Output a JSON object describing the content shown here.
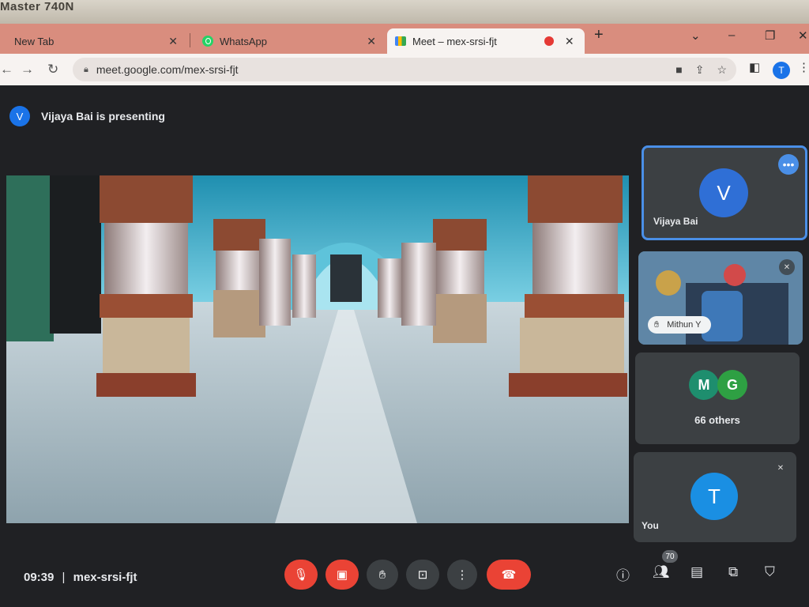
{
  "monitor": {
    "brand": "Master 740N"
  },
  "browser": {
    "tabs": [
      {
        "label": "New Tab"
      },
      {
        "label": "WhatsApp"
      },
      {
        "label": "Meet – mex-srsi-fjt"
      }
    ],
    "new_tab_symbol": "+",
    "url": "meet.google.com/mex-srsi-fjt",
    "profile_initial": "T"
  },
  "meet": {
    "presenting_initial": "V",
    "presenting_text": "Vijaya Bai is presenting",
    "participants": [
      {
        "name": "Vijaya Bai",
        "initial": "V",
        "color": "#2f6fd6",
        "speaking": true
      },
      {
        "name": "Mithun Y",
        "muted": true
      },
      {
        "initials": [
          "M",
          "G"
        ],
        "initial_colors": [
          "#1e8e6e",
          "#2ea043"
        ],
        "label": "66 others"
      },
      {
        "name": "You",
        "initial": "T",
        "color": "#1a8fe3",
        "muted": true
      }
    ],
    "time": "09:39",
    "separator": "|",
    "meeting_code": "mex-srsi-fjt",
    "participant_count": "70",
    "accent_red": "#ea4335"
  }
}
